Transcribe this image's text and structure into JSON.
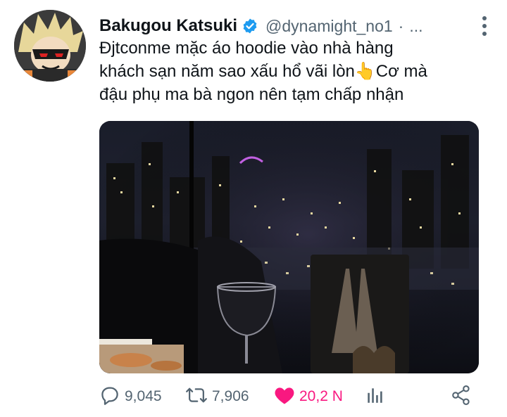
{
  "tweet": {
    "display_name": "Bakugou Katsuki",
    "handle": "@dynamight_no1",
    "separator": "·",
    "overflow": "...",
    "text_lines": [
      "Ðjtconme mặc áo hoodie vào nhà hàng",
      "khách sạn năm sao xấu hổ vãi lòn👆Cơ mà",
      "đậu phụ ma bà ngon nên tạm chấp nhận"
    ]
  },
  "actions": {
    "replies": "9,045",
    "retweets": "7,906",
    "likes": "20,2 N"
  },
  "colors": {
    "text": "#0f1419",
    "muted": "#536471",
    "verified": "#1d9bf0",
    "like": "#f91880"
  },
  "icons": [
    "verified-badge-icon",
    "more-vertical-icon",
    "reply-icon",
    "retweet-icon",
    "like-heart-icon",
    "analytics-icon",
    "share-icon"
  ]
}
